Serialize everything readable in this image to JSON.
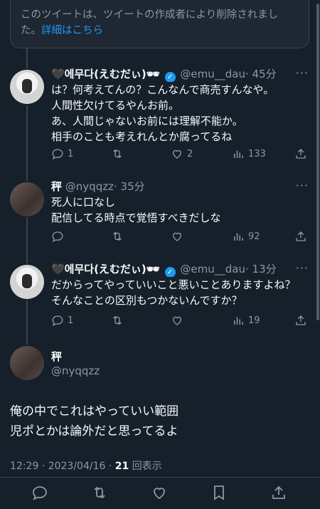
{
  "deleted_notice": {
    "text": "このツイートは、ツイートの作成者により削除されました。",
    "link": "詳細はこちら"
  },
  "replies": [
    {
      "name": "🖤에무다(えむだぃ)🕶",
      "handle": "@emu__dau",
      "time": "· 45分",
      "verified": true,
      "lines": [
        "は？何考えてんの？こんなんで商売すんなや。",
        "人間性欠けてるやんお前。",
        "あ、人間じゃないお前には理解不能か。",
        "相手のことも考えれんとか腐ってるね"
      ],
      "stats": {
        "reply": "1",
        "retweet": "",
        "like": "2",
        "views": "133"
      }
    },
    {
      "name": "秤",
      "handle": "@nyqqzz",
      "time": "· 35分",
      "verified": false,
      "lines": [
        "死人に口なし",
        "配信してる時点で覚悟すべきだしな"
      ],
      "stats": {
        "reply": "",
        "retweet": "",
        "like": "",
        "views": "92"
      }
    },
    {
      "name": "🖤에무다(えむだぃ)🕶",
      "handle": "@emu__dau",
      "time": "· 13分",
      "verified": true,
      "lines": [
        "だからってやっていいこと悪いことありますよね？",
        "そんなことの区別もつかないんですか？"
      ],
      "stats": {
        "reply": "1",
        "retweet": "",
        "like": "",
        "views": "19"
      }
    }
  ],
  "main_tweet": {
    "name": "秤",
    "handle": "@nyqqzz",
    "lines": [
      "俺の中でこれはやっていい範囲",
      "児ポとかは論外だと思ってるよ"
    ],
    "time": "12:29 · 2023/04/16 · ",
    "views_count": "21",
    "views_label": "回表示"
  },
  "more_glyph": "···",
  "colors": {
    "background": "#15202b",
    "accent": "#1d9bf0",
    "muted": "#8b98a5",
    "border": "#38444d"
  }
}
